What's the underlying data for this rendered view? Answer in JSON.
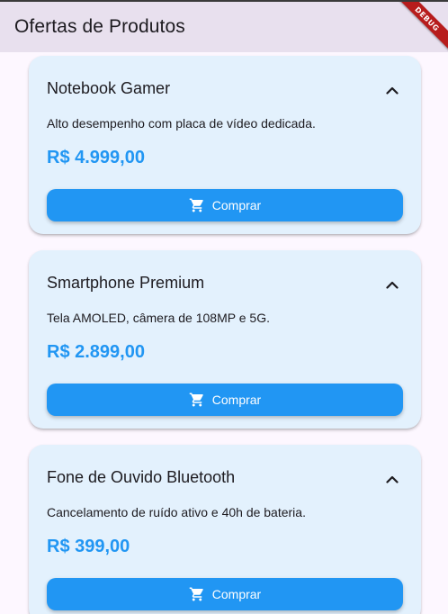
{
  "appbar": {
    "title": "Ofertas de Produtos"
  },
  "debug_banner": {
    "label": "DEBUG"
  },
  "products": [
    {
      "name": "Notebook Gamer",
      "description": "Alto desempenho com placa de vídeo dedicada.",
      "price": "R$ 4.999,00",
      "button_label": "Comprar",
      "expanded": true
    },
    {
      "name": "Smartphone Premium",
      "description": "Tela AMOLED, câmera de 108MP e 5G.",
      "price": "R$ 2.899,00",
      "button_label": "Comprar",
      "expanded": true
    },
    {
      "name": "Fone de Ouvido Bluetooth",
      "description": "Cancelamento de ruído ativo e 40h de bateria.",
      "price": "R$ 399,00",
      "button_label": "Comprar",
      "expanded": true
    }
  ],
  "icons": {
    "collapse": "chevron-up-icon",
    "cart": "shopping-cart-icon"
  },
  "colors": {
    "appbar_bg": "#e8e0ee",
    "card_bg": "#e3f1fd",
    "accent": "#2196f3",
    "debug": "#b71c1c"
  }
}
